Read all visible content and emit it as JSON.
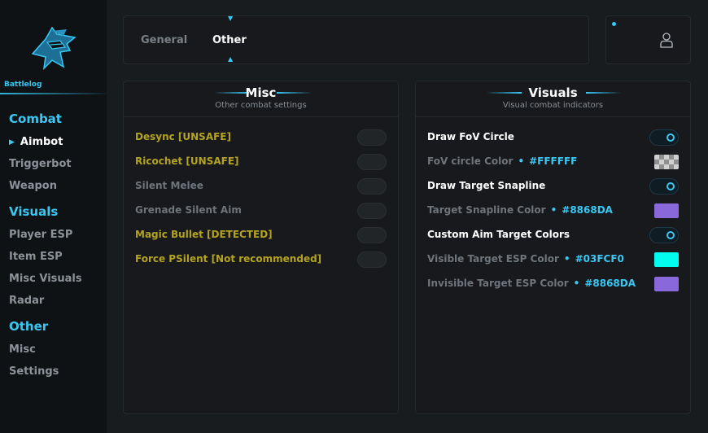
{
  "sidebar": {
    "brand": "Battlelog",
    "sections": [
      {
        "title": "Combat",
        "items": [
          {
            "label": "Aimbot",
            "active": true
          },
          {
            "label": "Triggerbot"
          },
          {
            "label": "Weapon"
          }
        ]
      },
      {
        "title": "Visuals",
        "items": [
          {
            "label": "Player ESP"
          },
          {
            "label": "Item ESP"
          },
          {
            "label": "Misc Visuals"
          },
          {
            "label": "Radar"
          }
        ]
      },
      {
        "title": "Other",
        "items": [
          {
            "label": "Misc"
          },
          {
            "label": "Settings"
          }
        ]
      }
    ]
  },
  "tabs": [
    {
      "label": "General",
      "active": false
    },
    {
      "label": "Other",
      "active": true
    }
  ],
  "user": {
    "icon": "user-icon",
    "status_color": "#3ac8f3"
  },
  "misc_panel": {
    "title": "Misc",
    "subtitle": "Other combat settings",
    "rows": [
      {
        "label": "Desync [UNSAFE]",
        "style": "warn",
        "enabled": false
      },
      {
        "label": "Ricochet [UNSAFE]",
        "style": "warn",
        "enabled": false
      },
      {
        "label": "Silent Melee",
        "style": "dim",
        "enabled": false
      },
      {
        "label": "Grenade Silent Aim",
        "style": "dim",
        "enabled": false
      },
      {
        "label": "Magic Bullet [DETECTED]",
        "style": "warn",
        "enabled": false
      },
      {
        "label": "Force PSilent [Not recommended]",
        "style": "warn",
        "enabled": false
      }
    ]
  },
  "visuals_panel": {
    "title": "Visuals",
    "subtitle": "Visual combat indicators",
    "rows": [
      {
        "label": "Draw FoV Circle",
        "kind": "toggle",
        "enabled": true
      },
      {
        "label": "FoV circle Color",
        "kind": "color",
        "hex": "#FFFFFF",
        "swatch": "checker"
      },
      {
        "label": "Draw Target Snapline",
        "kind": "toggle",
        "enabled": true
      },
      {
        "label": "Target Snapline Color",
        "kind": "color",
        "hex": "#8868DA",
        "swatch": "#8868DA"
      },
      {
        "label": "Custom Aim Target Colors",
        "kind": "toggle",
        "enabled": true
      },
      {
        "label": "Visible Target ESP Color",
        "kind": "color",
        "hex": "#03FCF0",
        "swatch": "#03FCF0"
      },
      {
        "label": "Invisible Target ESP Color",
        "kind": "color",
        "hex": "#8868DA",
        "swatch": "#8868DA"
      }
    ]
  },
  "colors": {
    "accent": "#3ac8f3",
    "warning": "#b3a320"
  }
}
